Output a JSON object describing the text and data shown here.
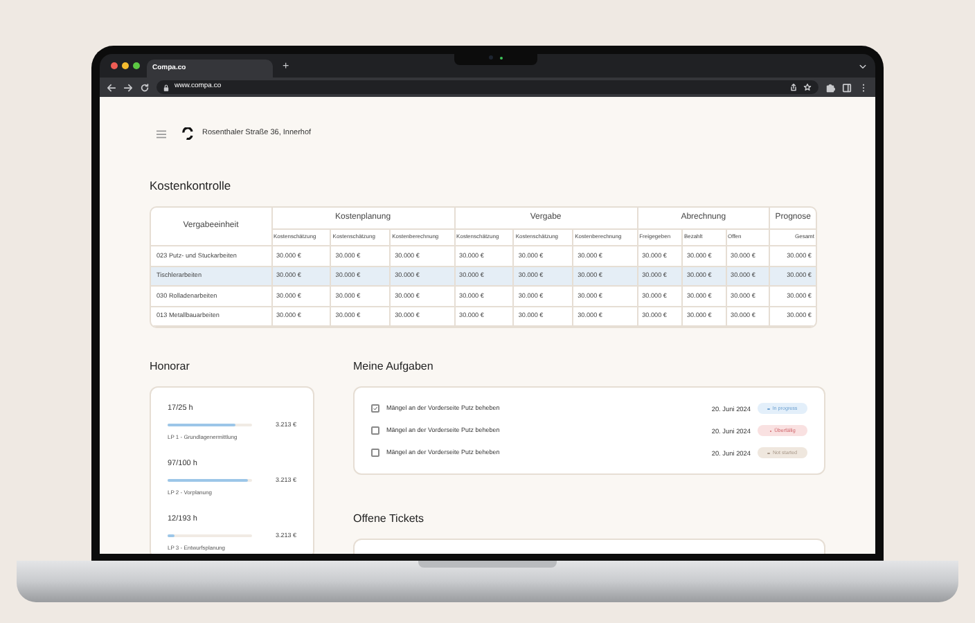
{
  "browser": {
    "tab_title": "Compa.co",
    "new_tab": "+",
    "url": "www.compa.co"
  },
  "header": {
    "address": "Rosenthaler Straße 36, Innerhof"
  },
  "kostenkontrolle": {
    "title": "Kostenkontrolle",
    "first_column": "Vergabeeinheit",
    "groups": [
      {
        "label": "Kostenplanung",
        "columns": [
          "Kostenschätzung",
          "Kostenschätzung",
          "Kostenberechnung"
        ]
      },
      {
        "label": "Vergabe",
        "columns": [
          "Kostenschätzung",
          "Kostenschätzung",
          "Kostenberechnung"
        ]
      },
      {
        "label": "Abrechnung",
        "columns": [
          "Freigegeben",
          "Bezahlt",
          "Offen"
        ]
      },
      {
        "label": "Prognose",
        "columns": [
          "Gesamt"
        ]
      }
    ],
    "rows": [
      {
        "name": "023 Putz- und Stuckarbeiten",
        "selected": false,
        "values": [
          "30.000 €",
          "30.000 €",
          "30.000 €",
          "30.000 €",
          "30.000 €",
          "30.000 €",
          "30.000 €",
          "30.000 €",
          "30.000 €",
          "30.000 €"
        ]
      },
      {
        "name": "Tischlerarbeiten",
        "selected": true,
        "values": [
          "30.000 €",
          "30.000 €",
          "30.000 €",
          "30.000 €",
          "30.000 €",
          "30.000 €",
          "30.000 €",
          "30.000 €",
          "30.000 €",
          "30.000 €"
        ]
      },
      {
        "name": "030 Rolladenarbeiten",
        "selected": false,
        "values": [
          "30.000 €",
          "30.000 €",
          "30.000 €",
          "30.000 €",
          "30.000 €",
          "30.000 €",
          "30.000 €",
          "30.000 €",
          "30.000 €",
          "30.000 €"
        ]
      },
      {
        "name": "013 Metallbauarbeiten",
        "selected": false,
        "values": [
          "30.000 €",
          "30.000 €",
          "30.000 €",
          "30.000 €",
          "30.000 €",
          "30.000 €",
          "30.000 €",
          "30.000 €",
          "30.000 €",
          "30.000 €"
        ]
      }
    ]
  },
  "honorar": {
    "title": "Honorar",
    "items": [
      {
        "hours": "17/25 h",
        "level": 0.8,
        "amount": "3.213 €",
        "label": "LP 1 - Grundlagenermittlung"
      },
      {
        "hours": "97/100 h",
        "level": 0.95,
        "amount": "3.213 €",
        "label": "LP 2 - Vorplanung"
      },
      {
        "hours": "12/193 h",
        "level": 0.08,
        "amount": "3.213 €",
        "label": "LP 3 - Entwurfsplanung"
      }
    ]
  },
  "aufgaben": {
    "title": "Meine Aufgaben",
    "tasks": [
      {
        "text": "Mängel an der Vorderseite Putz beheben",
        "checked": true,
        "date": "20. Juni 2024",
        "status": "In progress",
        "kind": "in_progress"
      },
      {
        "text": "Mängel an der Vorderseite Putz beheben",
        "checked": false,
        "date": "20. Juni 2024",
        "status": "Überfällig",
        "kind": "overdue"
      },
      {
        "text": "Mängel an der Vorderseite Putz beheben",
        "checked": false,
        "date": "20. Juni 2024",
        "status": "Not started",
        "kind": "not_started"
      }
    ]
  },
  "tickets": {
    "title": "Offene Tickets"
  }
}
